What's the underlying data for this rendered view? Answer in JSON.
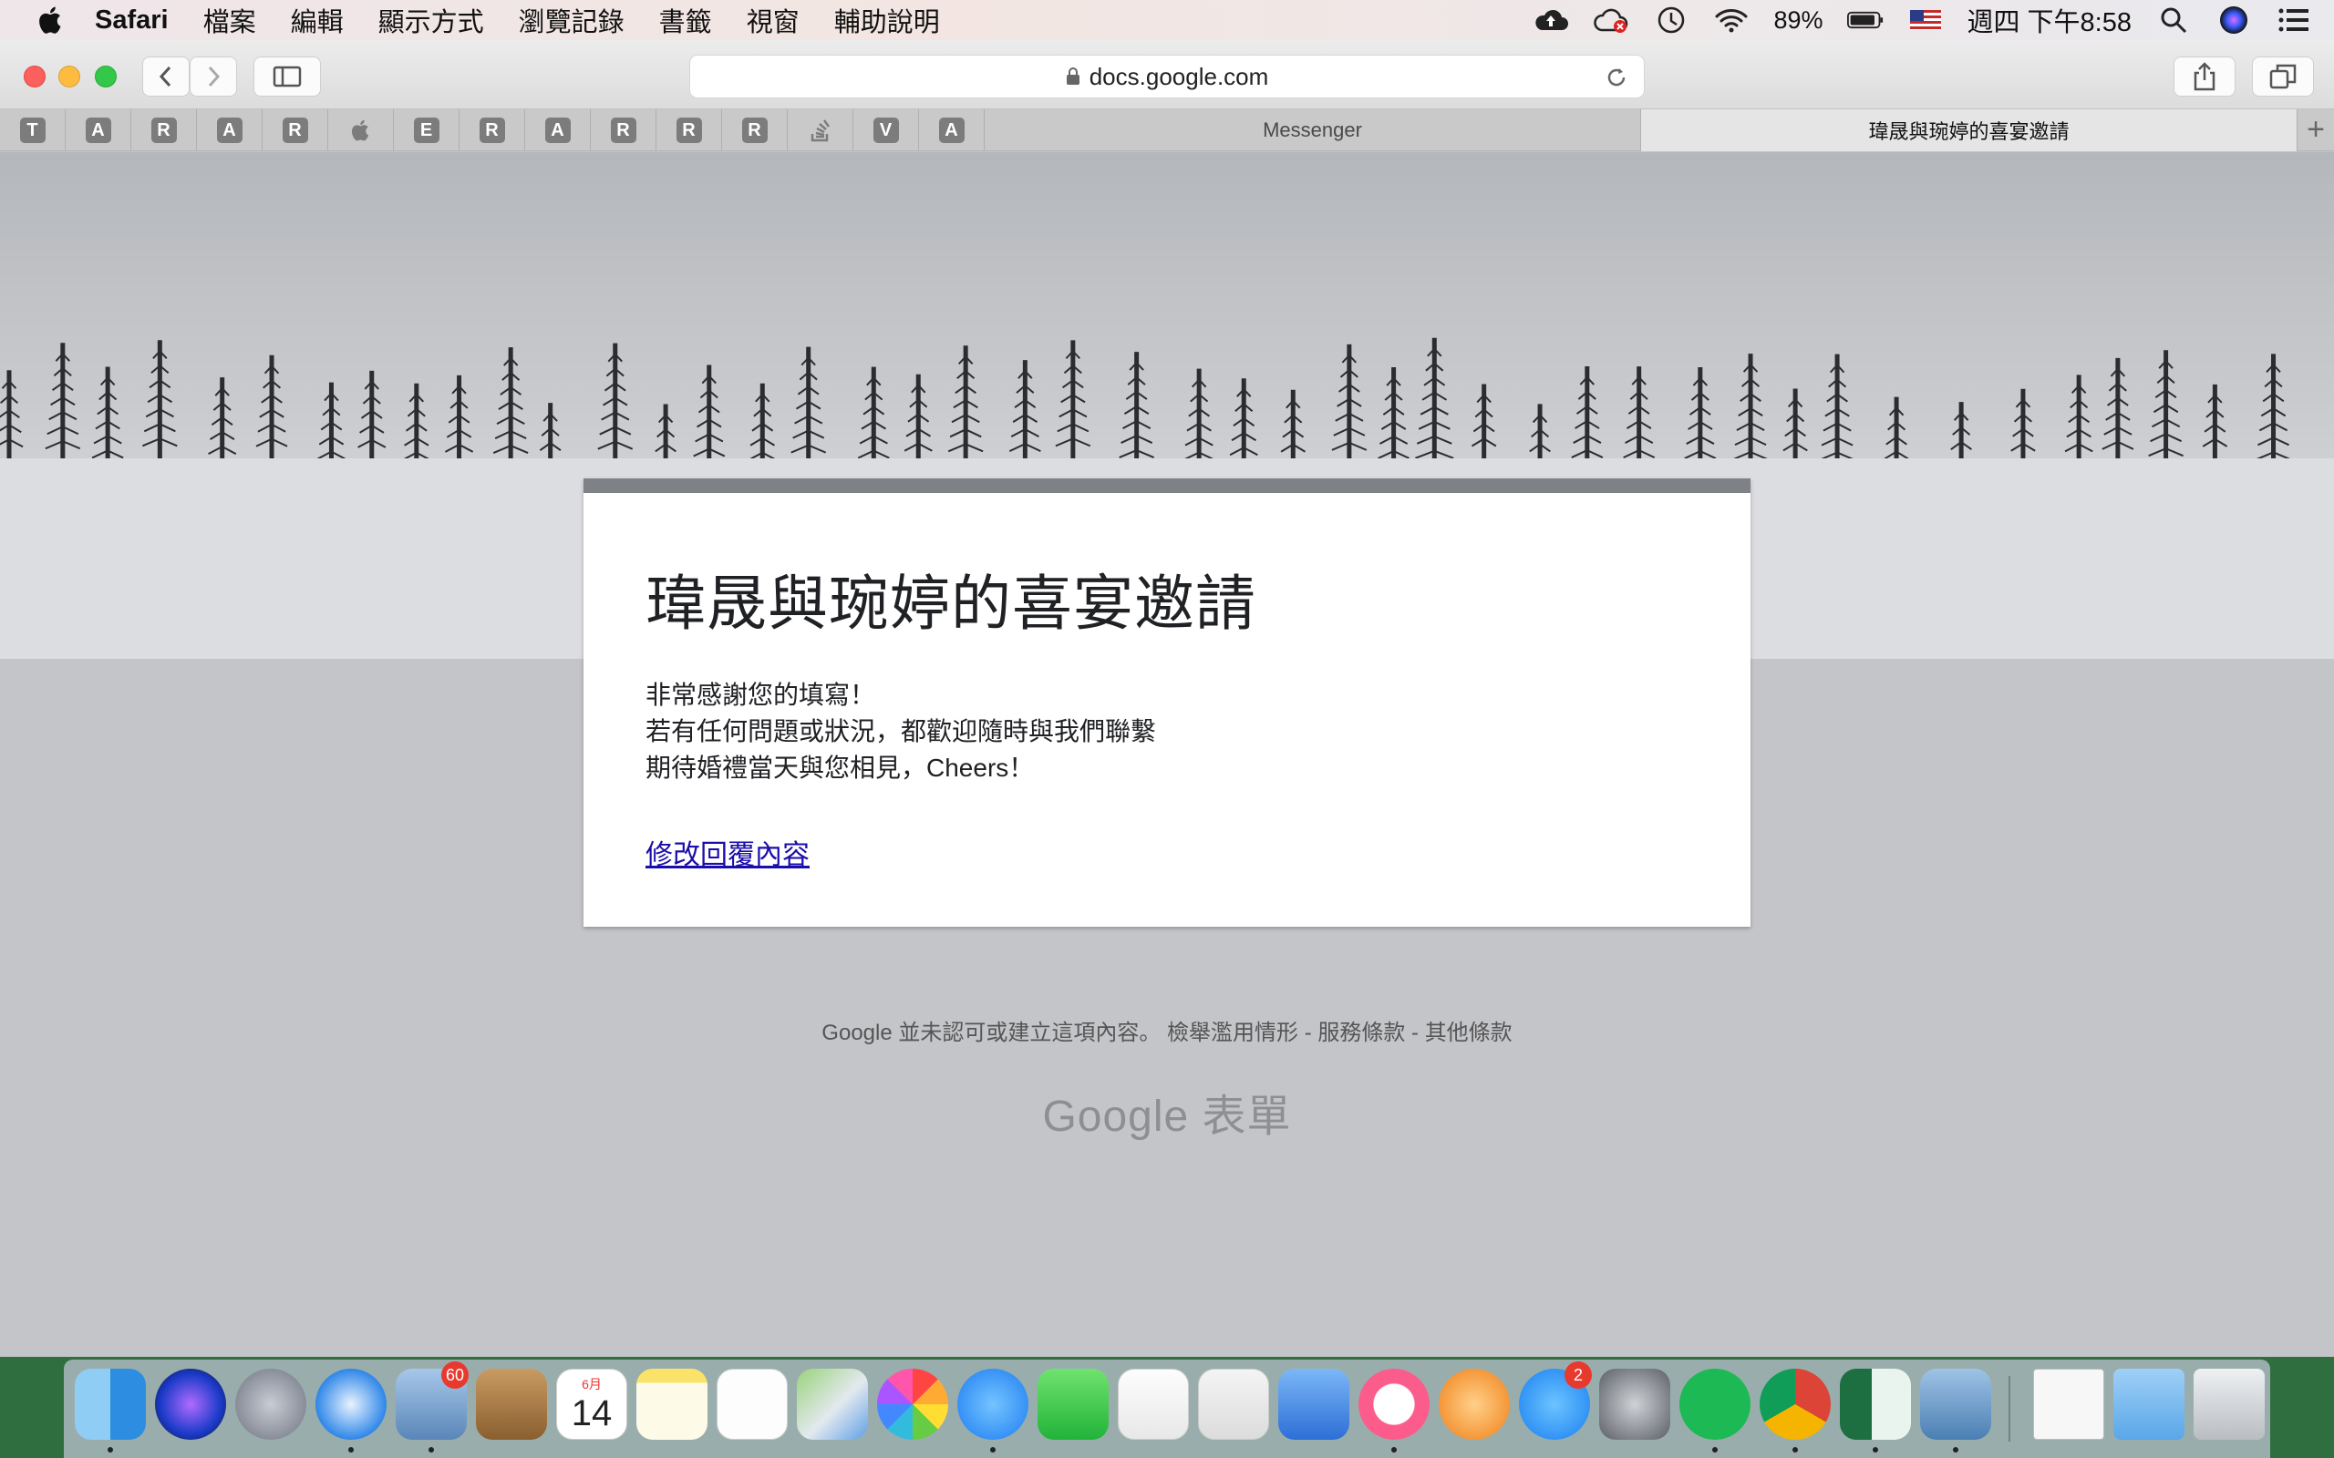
{
  "menubar": {
    "app_name": "Safari",
    "items": [
      "檔案",
      "編輯",
      "顯示方式",
      "瀏覽記錄",
      "書籤",
      "視窗",
      "輔助說明"
    ],
    "battery": "89%",
    "clock": "週四 下午8:58"
  },
  "toolbar": {
    "address": "docs.google.com"
  },
  "tabs": {
    "pinned": [
      "T",
      "A",
      "R",
      "A",
      "R",
      "",
      "E",
      "R",
      "A",
      "R",
      "R",
      "R",
      "",
      "V",
      "A"
    ],
    "inactive_title": "Messenger",
    "active_title": "瑋晟與琬婷的喜宴邀請"
  },
  "form": {
    "title": "瑋晟與琬婷的喜宴邀請",
    "message_line1": "非常感謝您的填寫！",
    "message_line2": "若有任何問題或狀況，都歡迎隨時與我們聯繫",
    "message_line3": "期待婚禮當天與您相見，Cheers！",
    "edit_link": "修改回覆內容"
  },
  "footer": {
    "disclaimer": "Google 並未認可或建立這項內容。",
    "report": "檢舉濫用情形",
    "terms": "服務條款",
    "other": "其他條款",
    "separator": " - ",
    "brand": "Google 表單"
  },
  "dock": {
    "mail_badge": "60",
    "appstore_badge": "2",
    "calendar_month": "6月",
    "calendar_day": "14"
  },
  "colors": {
    "accent_bar": "#7e8287",
    "link": "#1a0dab",
    "page_bg": "#c4c5c9"
  }
}
